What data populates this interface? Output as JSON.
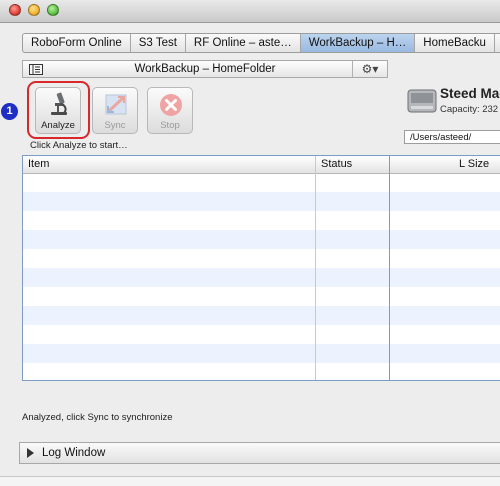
{
  "window": {
    "controls": [
      "close",
      "minimize",
      "zoom"
    ]
  },
  "tabs": [
    {
      "label": "RoboForm Online",
      "active": false
    },
    {
      "label": "S3 Test",
      "active": false
    },
    {
      "label": "RF Online – aste…",
      "active": false
    },
    {
      "label": "WorkBackup – H…",
      "active": true
    },
    {
      "label": "HomeBacku",
      "active": false
    }
  ],
  "panel": {
    "title": "WorkBackup – HomeFolder",
    "gear_symbol": "⚙▾",
    "buttons": {
      "analyze": "Analyze",
      "sync": "Sync",
      "stop": "Stop"
    },
    "hint": "Click Analyze to start…",
    "callout_number": "1"
  },
  "destination": {
    "drive_name": "Steed Mac",
    "capacity": "Capacity: 232",
    "path": "/Users/asteed/"
  },
  "table": {
    "columns": [
      "Item",
      "Status",
      "L Size"
    ],
    "row_count": 11
  },
  "status": "Analyzed, click Sync to synchronize",
  "log_window": {
    "label": "Log Window"
  },
  "colors": {
    "selected_tab": "#a8c4e6",
    "callout_red": "#d9282a",
    "badge_blue": "#1f2fc5",
    "row_stripe": "#edf3fe"
  },
  "icons": [
    "microscope-icon",
    "sync-icon",
    "stop-icon",
    "gear-icon",
    "hard-drive-icon",
    "disclosure-triangle-icon",
    "sidebar-toggle-icon"
  ]
}
